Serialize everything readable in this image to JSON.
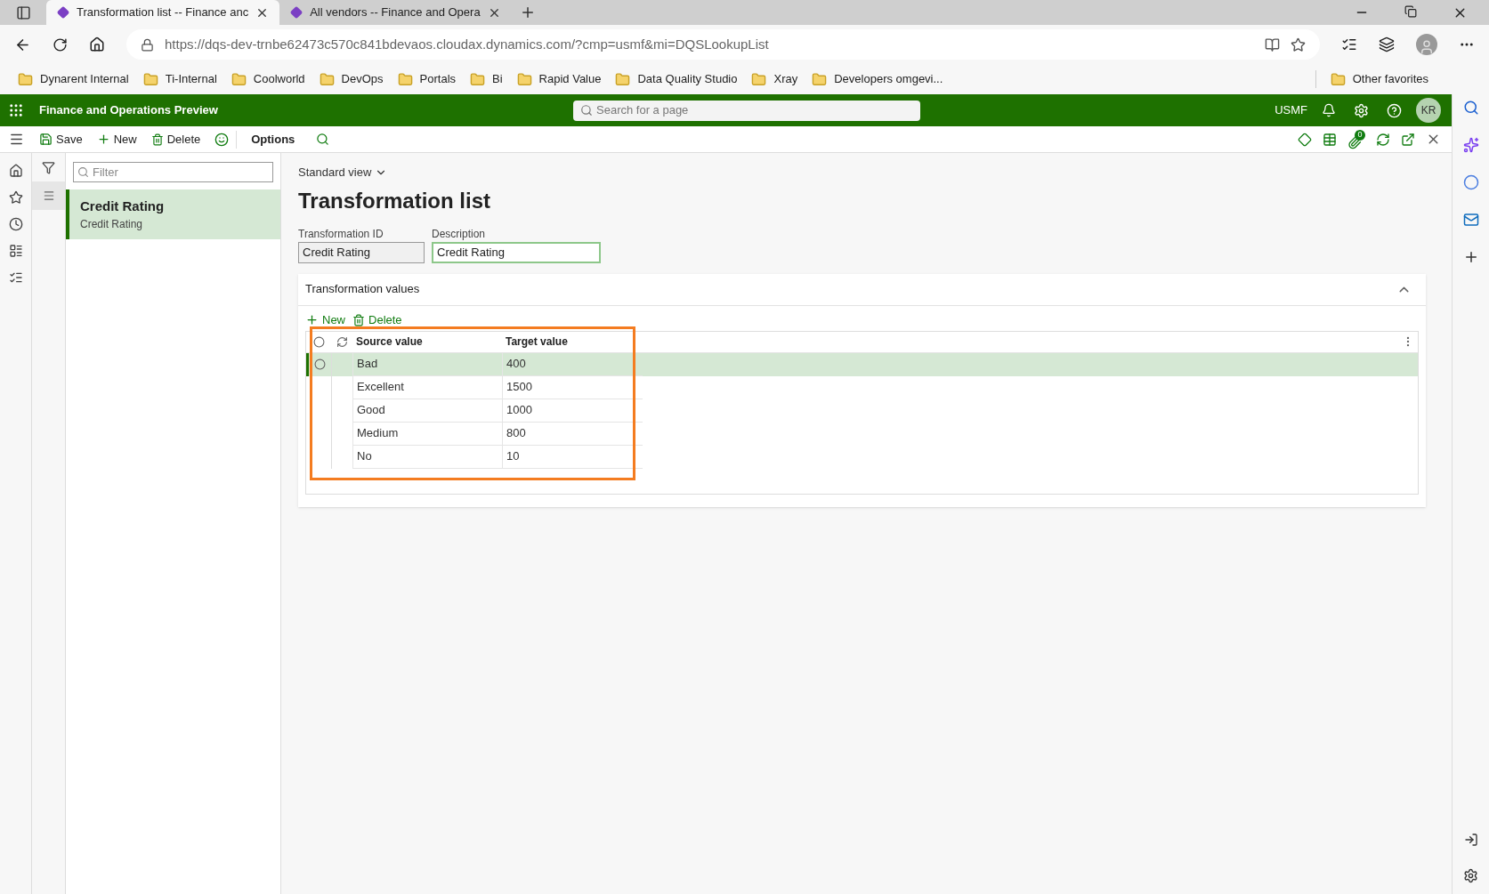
{
  "browser_tabs": [
    {
      "title": "Transformation list -- Finance anc",
      "selected": true
    },
    {
      "title": "All vendors -- Finance and Opera",
      "selected": false
    }
  ],
  "address": "https://dqs-dev-trnbe62473c570c841bdevaos.cloudax.dynamics.com/?cmp=usmf&mi=DQSLookupList",
  "bookmarks": [
    "Dynarent Internal",
    "Ti-Internal",
    "Coolworld",
    "DevOps",
    "Portals",
    "Bi",
    "Rapid Value",
    "Data Quality Studio",
    "Xray",
    "Developers omgevi..."
  ],
  "other_favorites": "Other favorites",
  "app": {
    "title": "Finance and Operations Preview",
    "search_placeholder": "Search for a page",
    "company": "USMF",
    "avatar": "KR"
  },
  "toolbar": [
    {
      "label": "Save",
      "kind": "save"
    },
    {
      "label": "New",
      "kind": "new"
    },
    {
      "label": "Delete",
      "kind": "delete"
    },
    {
      "label": "Options",
      "kind": "options"
    }
  ],
  "attachment_count": "0",
  "list": {
    "filter_placeholder": "Filter",
    "items": [
      {
        "title": "Credit Rating",
        "subtitle": "Credit Rating",
        "selected": true
      }
    ]
  },
  "view": "Standard view",
  "page_title": "Transformation list",
  "fields": [
    {
      "label": "Transformation ID",
      "value": "Credit Rating",
      "kind": "readonly"
    },
    {
      "label": "Description",
      "value": "Credit Rating",
      "kind": "editable"
    }
  ],
  "section": {
    "title": "Transformation values",
    "expanded": true,
    "all_selected": false,
    "actions": [
      {
        "label": "New",
        "kind": "new"
      },
      {
        "label": "Delete",
        "kind": "delete"
      }
    ],
    "columns": [
      "Source value",
      "Target value"
    ],
    "rows": [
      {
        "source": "Bad",
        "target": "400",
        "selected": true
      },
      {
        "source": "Excellent",
        "target": "1500",
        "selected": false
      },
      {
        "source": "Good",
        "target": "1000",
        "selected": false
      },
      {
        "source": "Medium",
        "target": "800",
        "selected": false
      },
      {
        "source": "No",
        "target": "10",
        "selected": false
      }
    ]
  }
}
